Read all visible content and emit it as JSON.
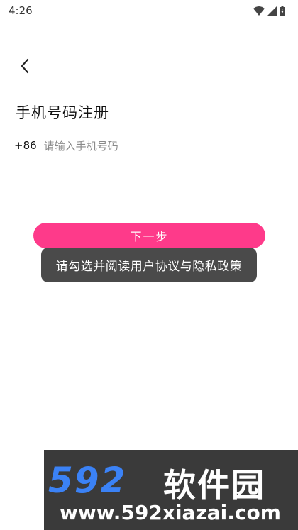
{
  "status_bar": {
    "time": "4:26",
    "icons": [
      "wifi-icon",
      "signal-icon",
      "battery-icon"
    ]
  },
  "nav": {
    "back_icon": "chevron-left-icon"
  },
  "page": {
    "title": "手机号码注册"
  },
  "phone": {
    "country_code": "+86",
    "placeholder": "请输入手机号码",
    "value": ""
  },
  "actions": {
    "next_label": "下一步"
  },
  "toast": {
    "message": "请勾选并阅读用户协议与隐私政策"
  },
  "watermark": {
    "logo_number": "592",
    "logo_text": "软件园",
    "url": "www.592xiazai.com"
  },
  "colors": {
    "accent": "#fe3a8a",
    "toast_bg": "#4a4a4a",
    "watermark_bg": "#3a3a3a",
    "watermark_blue": "#3b82f6"
  }
}
